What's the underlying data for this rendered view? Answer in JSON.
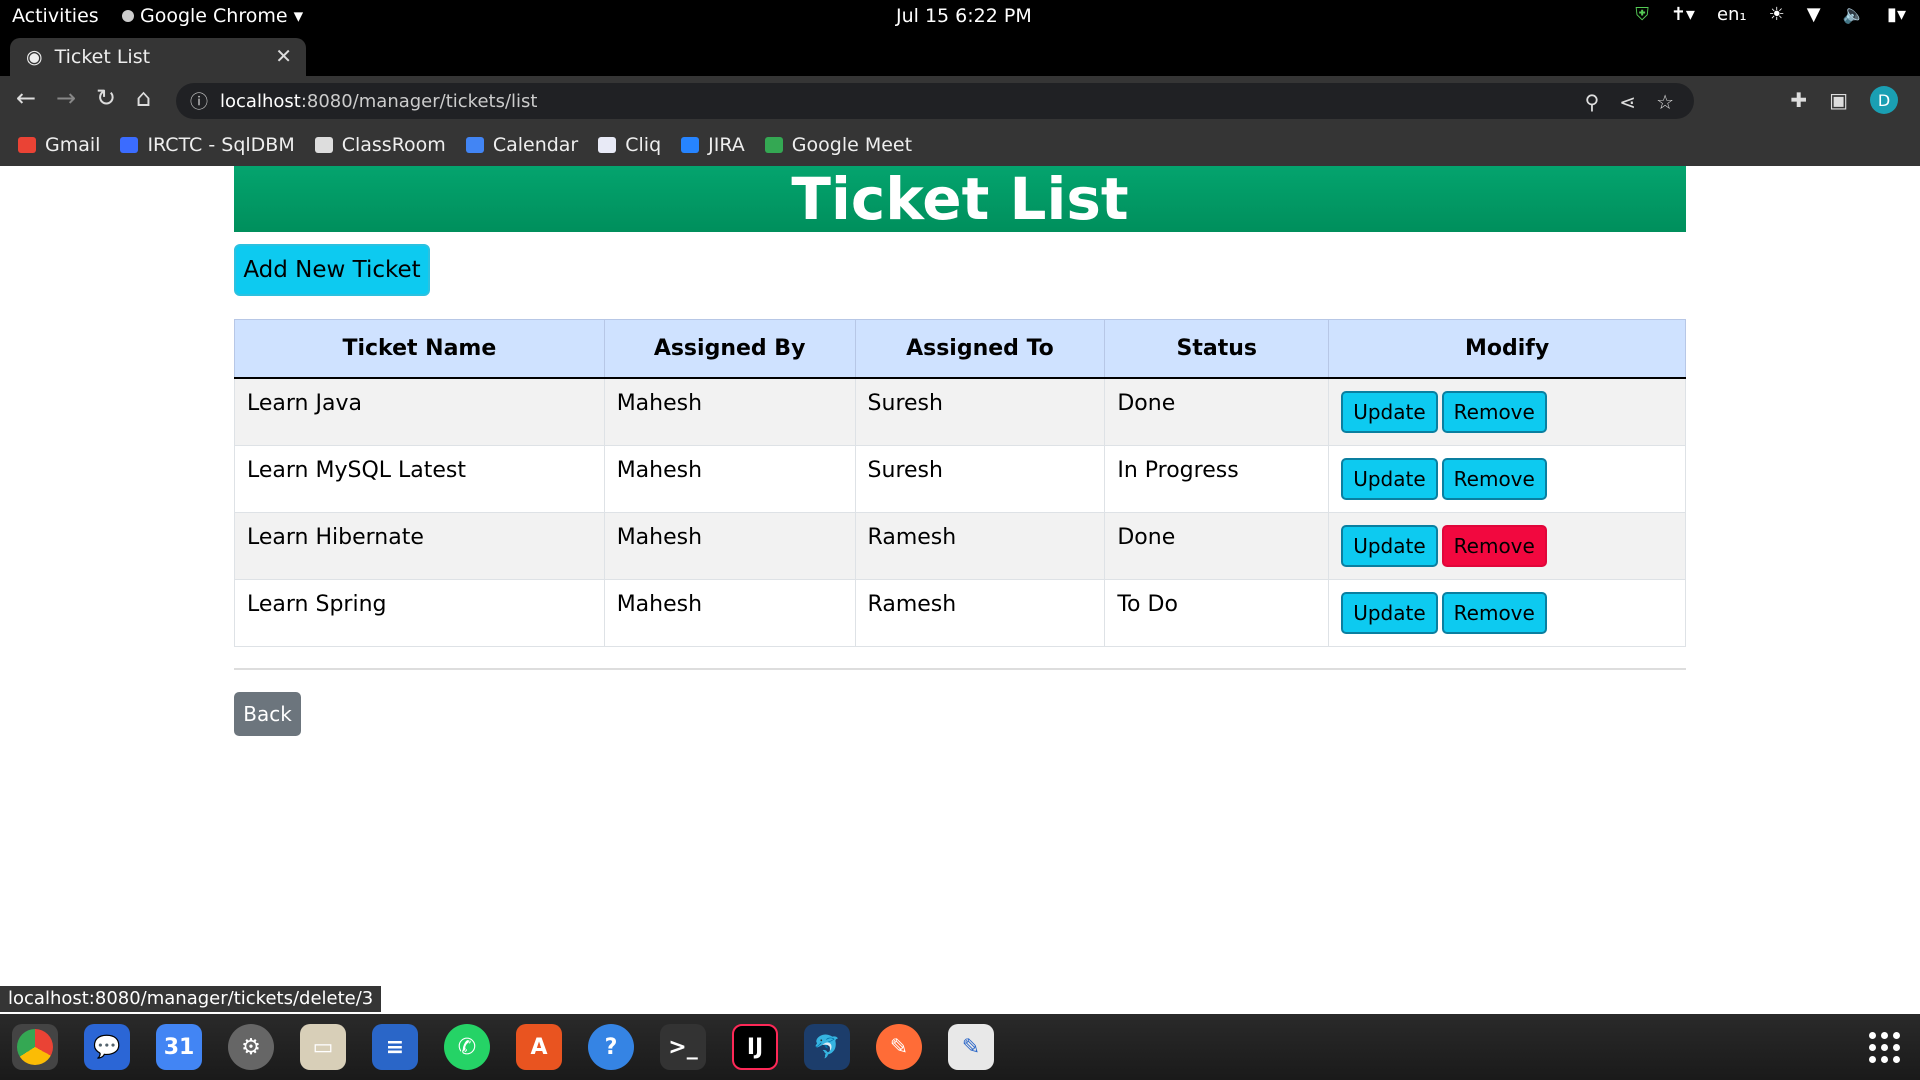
{
  "system_bar": {
    "activities": "Activities",
    "app_name": "Google Chrome",
    "clock": "Jul 15  6:22 PM",
    "keyboard_layout": "en₁"
  },
  "browser": {
    "tab_title": "Ticket List",
    "url_host": "localhost",
    "url_path": ":8080/manager/tickets/list",
    "profile_initial": "D",
    "bookmarks": [
      "Gmail",
      "IRCTC - SqlDBM",
      "ClassRoom",
      "Calendar",
      "Cliq",
      "JIRA",
      "Google Meet"
    ],
    "status_url": "localhost:8080/manager/tickets/delete/3"
  },
  "page": {
    "title": "Ticket List",
    "add_button": "Add New Ticket",
    "back_button": "Back",
    "columns": [
      "Ticket Name",
      "Assigned By",
      "Assigned To",
      "Status",
      "Modify"
    ],
    "rows": [
      {
        "name": "Learn Java",
        "by": "Mahesh",
        "to": "Suresh",
        "status": "Done"
      },
      {
        "name": "Learn MySQL Latest",
        "by": "Mahesh",
        "to": "Suresh",
        "status": "In Progress"
      },
      {
        "name": "Learn Hibernate",
        "by": "Mahesh",
        "to": "Ramesh",
        "status": "Done"
      },
      {
        "name": "Learn Spring",
        "by": "Mahesh",
        "to": "Ramesh",
        "status": "To Do"
      }
    ],
    "update_label": "Update",
    "remove_label": "Remove",
    "colors": {
      "banner": "#009966",
      "info_button": "#0dcaf0",
      "danger_hover": "#f2083f",
      "header_row": "#cfe2ff",
      "back_button": "#6c757d"
    }
  }
}
